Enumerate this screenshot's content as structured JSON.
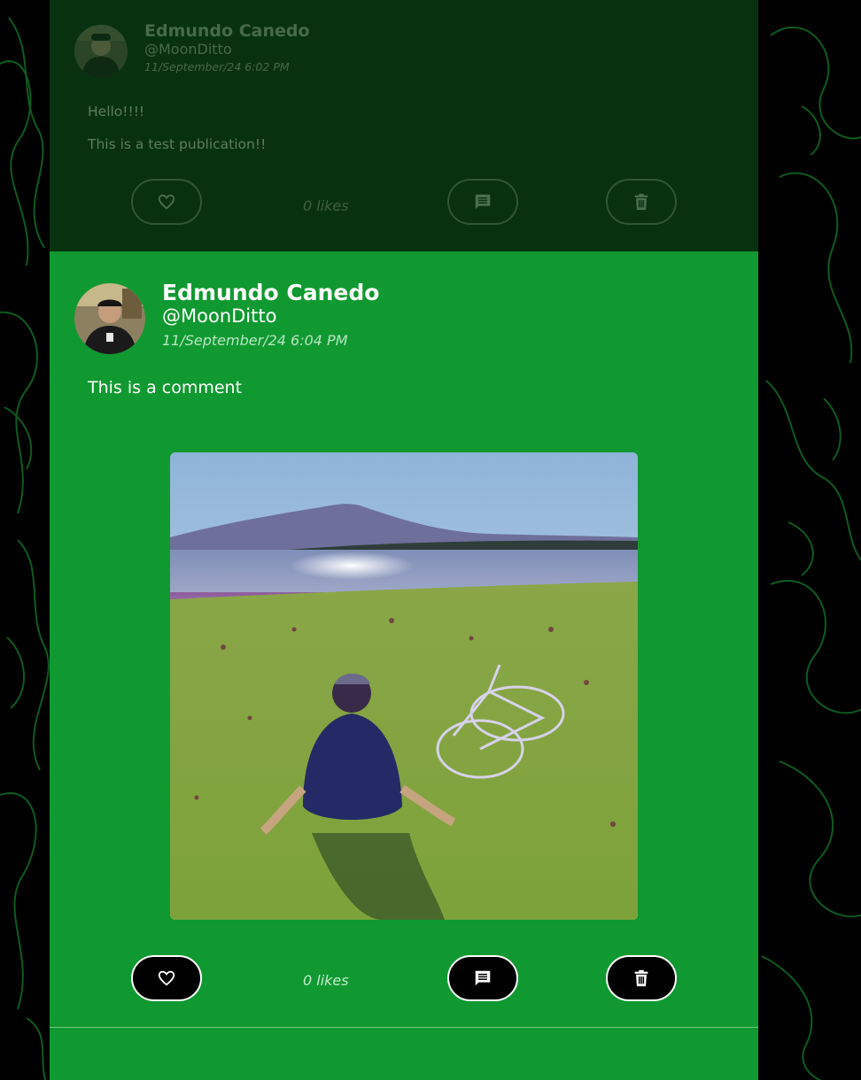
{
  "parent_post": {
    "author_name": "Edmundo Canedo",
    "author_handle": "@MoonDitto",
    "date": "11/September/24 6:02 PM",
    "text_lines": [
      "Hello!!!!",
      "This is a test publication!!"
    ],
    "likes": "0 likes",
    "icons": [
      "heart-icon",
      "comment-icon",
      "trash-icon"
    ]
  },
  "comment": {
    "author_name": "Edmundo Canedo",
    "author_handle": "@MoonDitto",
    "date": "11/September/24 6:04 PM",
    "text": "This is a comment",
    "likes": "0 likes",
    "icons": [
      "heart-icon",
      "comment-icon",
      "trash-icon"
    ]
  },
  "colors": {
    "background": "#000000",
    "topo_lines": "#0f5a1f",
    "card_green": "#109930",
    "dim_card": "#08320f",
    "button_bg": "#000000",
    "button_border": "#ffffff"
  }
}
